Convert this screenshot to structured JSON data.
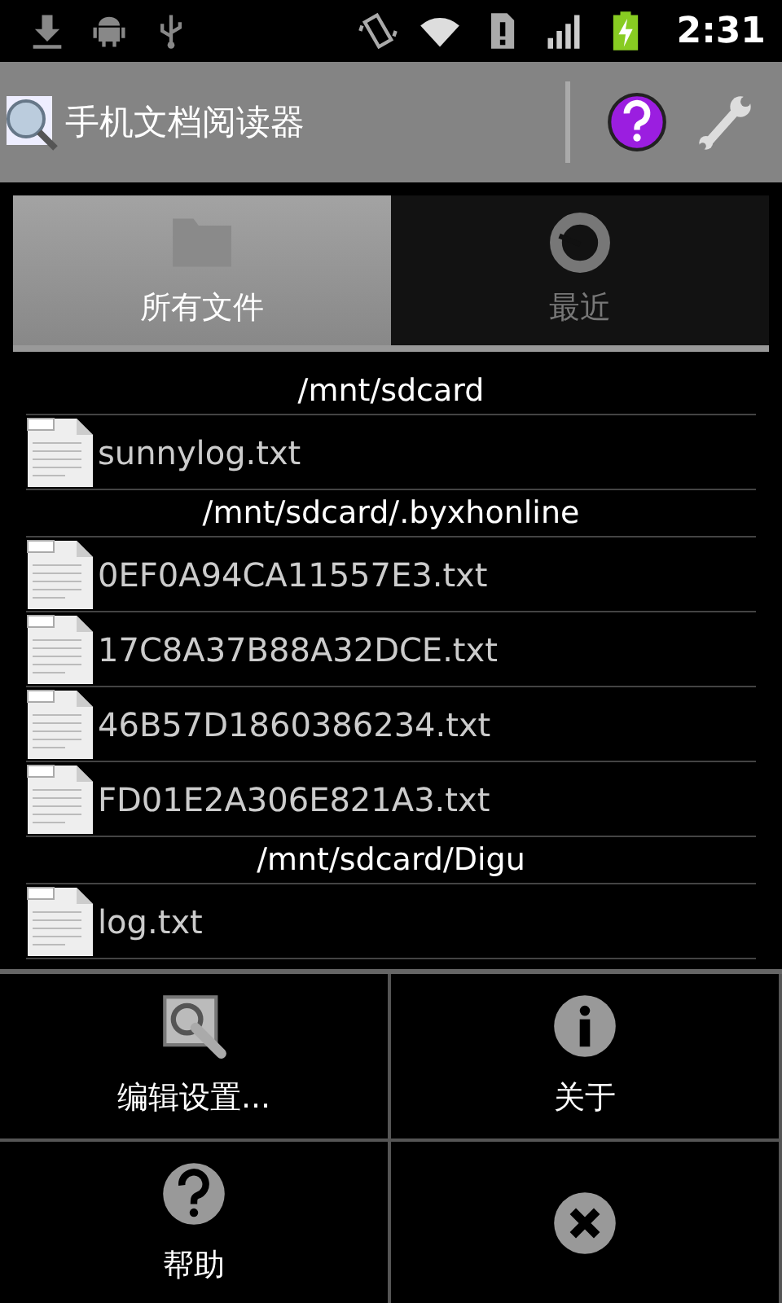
{
  "status_bar": {
    "time": "2:31"
  },
  "title_bar": {
    "title": "手机文档阅读器"
  },
  "tabs": [
    {
      "label": "所有文件",
      "kind": "folder",
      "selected": true
    },
    {
      "label": "最近",
      "kind": "recent",
      "selected": false
    }
  ],
  "file_list": [
    {
      "path": "/mnt/sdcard",
      "files": [
        "sunnylog.txt"
      ]
    },
    {
      "path": "/mnt/sdcard/.byxhonline",
      "files": [
        "0EF0A94CA11557E3.txt",
        "17C8A37B88A32DCE.txt",
        "46B57D1860386234.txt",
        "FD01E2A306E821A3.txt"
      ]
    },
    {
      "path": "/mnt/sdcard/Digu",
      "files": [
        "log.txt"
      ]
    }
  ],
  "menu": [
    {
      "label": "编辑设置...",
      "kind": "settings"
    },
    {
      "label": "关于",
      "kind": "about"
    },
    {
      "label": "帮助",
      "kind": "help"
    },
    {
      "kind": "close"
    }
  ]
}
